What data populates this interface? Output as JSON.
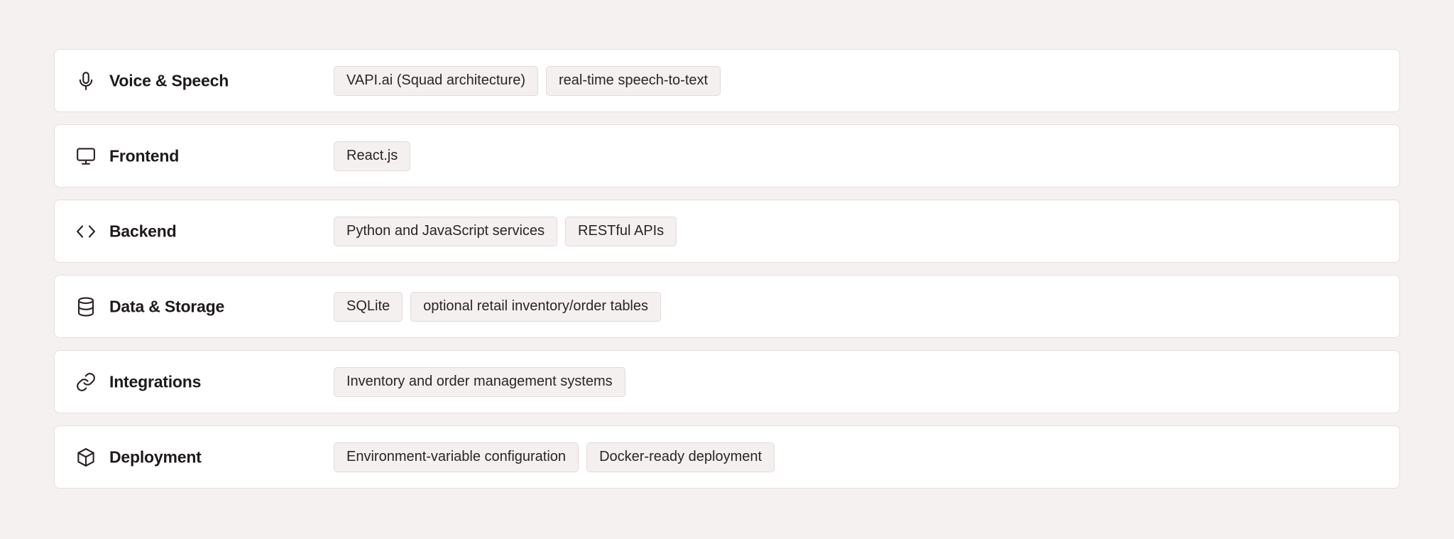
{
  "categories": [
    {
      "label": "Voice & Speech",
      "icon": "microphone-icon",
      "chips": [
        "VAPI.ai (Squad architecture)",
        "real-time speech-to-text"
      ]
    },
    {
      "label": "Frontend",
      "icon": "monitor-icon",
      "chips": [
        "React.js"
      ]
    },
    {
      "label": "Backend",
      "icon": "code-icon",
      "chips": [
        "Python and JavaScript services",
        "RESTful APIs"
      ]
    },
    {
      "label": "Data & Storage",
      "icon": "database-icon",
      "chips": [
        "SQLite",
        "optional retail inventory/order tables"
      ]
    },
    {
      "label": "Integrations",
      "icon": "link-icon",
      "chips": [
        "Inventory and order management systems"
      ]
    },
    {
      "label": "Deployment",
      "icon": "package-icon",
      "chips": [
        "Environment-variable configuration",
        "Docker-ready deployment"
      ]
    }
  ]
}
